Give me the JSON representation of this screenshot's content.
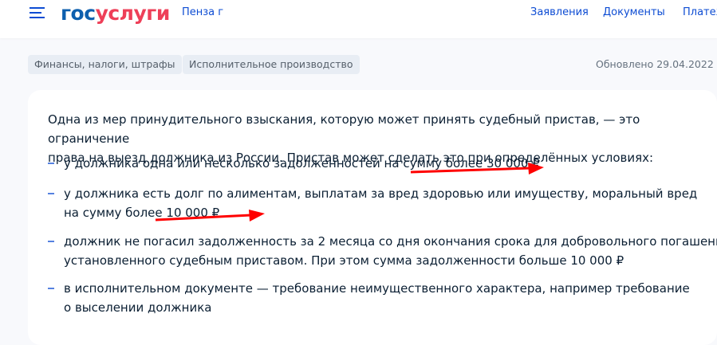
{
  "header": {
    "logo_part1": "гос",
    "logo_part2": "услуги",
    "city": "Пенза г",
    "nav": [
      "Заявления",
      "Документы",
      "Платежи"
    ]
  },
  "tags": [
    "Финансы, налоги, штрафы",
    "Исполнительное производство"
  ],
  "updated": "Обновлено 29.04.2022",
  "content": {
    "intro_line1": "Одна из мер принудительного взыскания, которую может принять судебный пристав, — это ограничение",
    "intro_line2": "права на выезд должника из России. Пристав может сделать это при определённых условиях:",
    "items": [
      {
        "line1": "у должника одна или несколько задолженностей на сумму более 30 000 ₽"
      },
      {
        "line1": "у должника есть долг по алиментам, выплатам за вред здоровью или имуществу, моральный вред",
        "line2": "на сумму более 10 000 ₽"
      },
      {
        "line1": "должник не погасил задолженность за 2 месяца со дня окончания срока для добровольного погашения,",
        "line2": "установленного судебным приставом. При этом сумма задолженности больше 10 000 ₽"
      },
      {
        "line1": "в исполнительном документе — требование неимущественного характера, например требование",
        "line2": "о выселении должника"
      }
    ]
  },
  "colors": {
    "accent": "#0d4cd3",
    "annotation": "#ff0000"
  }
}
